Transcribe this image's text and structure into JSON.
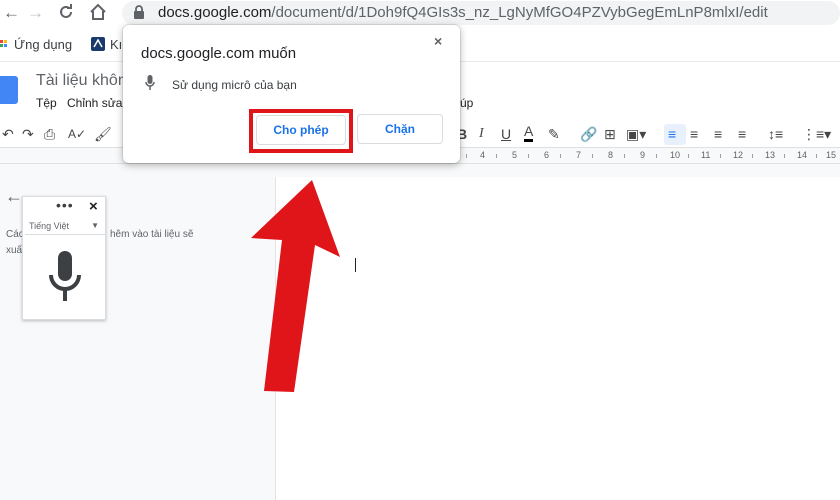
{
  "browser": {
    "url_host": "docs.google.com",
    "url_path": "/document/d/1Doh9fQ4GIs3s_nz_LgNyMfGO4PZVybGegEmLnP8mlxI/edit",
    "bookmarks": [
      {
        "label": "Ứng dụng"
      },
      {
        "label": "Kı"
      }
    ]
  },
  "docs": {
    "title": "Tài liệu không",
    "menu": [
      "Tệp",
      "Chỉnh sửa",
      "úp"
    ],
    "toolbar_glyphs": {
      "bold": "B",
      "italic": "I",
      "underline": "U",
      "text_color": "A"
    },
    "ruler_numbers": [
      "4",
      "5",
      "6",
      "7",
      "8",
      "9",
      "10",
      "11",
      "12",
      "13",
      "14",
      "15"
    ]
  },
  "outline": {
    "text_left": "Các",
    "text_left2": "xuấ",
    "text_right": "hêm vào tài liệu sẽ"
  },
  "voice_typing": {
    "dots": "•••",
    "close": "×",
    "language": "Tiếng Việt"
  },
  "permission_popup": {
    "title": "docs.google.com muốn",
    "close": "×",
    "request": "Sử dụng micrô của bạn",
    "allow_label": "Cho phép",
    "block_label": "Chặn"
  },
  "colors": {
    "highlight": "#e0151a",
    "accent": "#1a73e8",
    "docs_blue": "#4285f4"
  }
}
